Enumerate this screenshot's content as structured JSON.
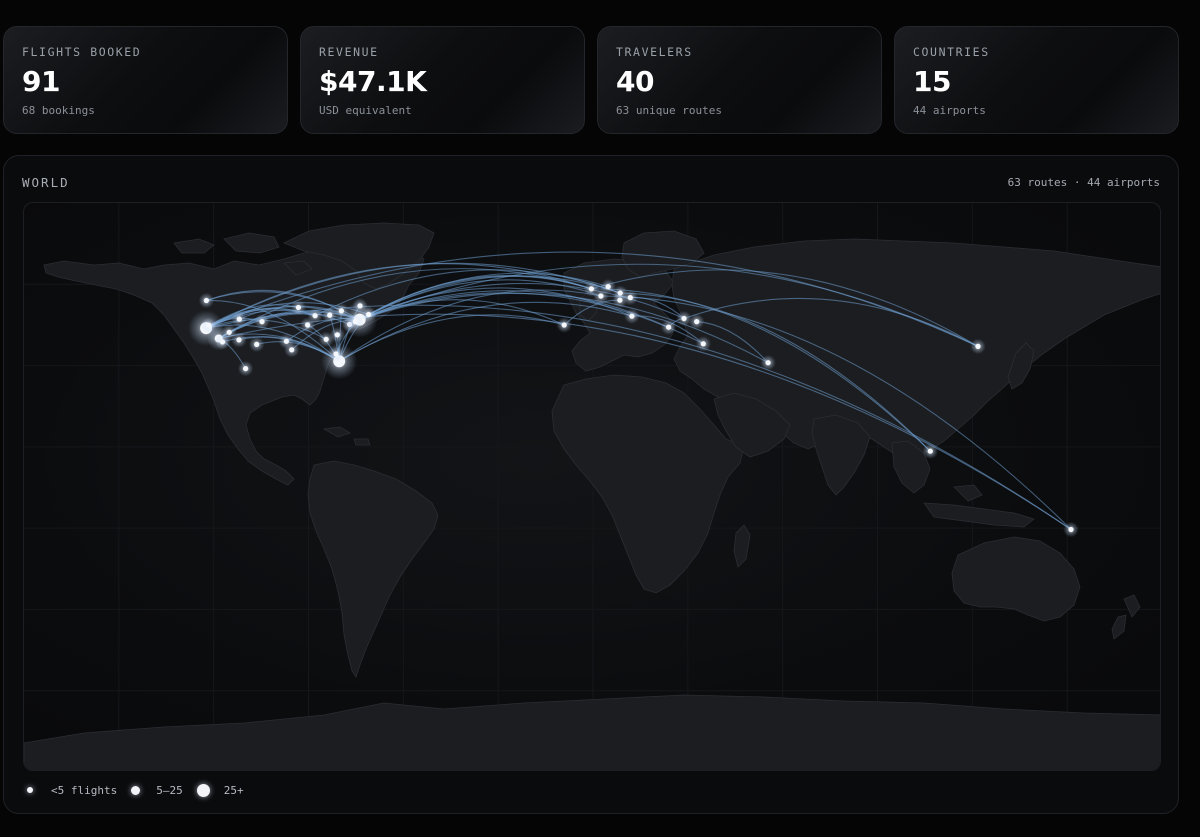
{
  "stats": [
    {
      "label": "FLIGHTS BOOKED",
      "value": "91",
      "sub": "68 bookings"
    },
    {
      "label": "REVENUE",
      "value": "$47.1K",
      "sub": "USD equivalent"
    },
    {
      "label": "TRAVELERS",
      "value": "40",
      "sub": "63 unique routes"
    },
    {
      "label": "COUNTRIES",
      "value": "15",
      "sub": "44 airports"
    }
  ],
  "panel": {
    "title": "WORLD",
    "meta": "63 routes · 44 airports"
  },
  "legend": {
    "small": "<5 flights",
    "medium": "5–25",
    "large": "25+"
  },
  "colors": {
    "route": "#6f9fd0",
    "airport": "#f4f7fb",
    "land": "#1b1d20",
    "background": "#050506"
  },
  "airports": [
    {
      "lon": -122.4,
      "lat": 37.6,
      "tier": "large"
    },
    {
      "lon": -118.4,
      "lat": 33.9,
      "tier": "medium"
    },
    {
      "lon": -122.3,
      "lat": 47.4,
      "tier": "small"
    },
    {
      "lon": -121.5,
      "lat": 38.6,
      "tier": "small"
    },
    {
      "lon": -111.9,
      "lat": 40.8,
      "tier": "small"
    },
    {
      "lon": -104.7,
      "lat": 39.9,
      "tier": "small"
    },
    {
      "lon": -112.0,
      "lat": 33.4,
      "tier": "small"
    },
    {
      "lon": -115.1,
      "lat": 36.1,
      "tier": "small"
    },
    {
      "lon": -117.2,
      "lat": 32.7,
      "tier": "small"
    },
    {
      "lon": -97.0,
      "lat": 32.9,
      "tier": "small"
    },
    {
      "lon": -95.3,
      "lat": 29.9,
      "tier": "small"
    },
    {
      "lon": -93.2,
      "lat": 44.9,
      "tier": "small"
    },
    {
      "lon": -87.9,
      "lat": 42.0,
      "tier": "small"
    },
    {
      "lon": -90.3,
      "lat": 38.7,
      "tier": "small"
    },
    {
      "lon": -84.4,
      "lat": 33.6,
      "tier": "small"
    },
    {
      "lon": -83.3,
      "lat": 42.2,
      "tier": "small"
    },
    {
      "lon": -77.0,
      "lat": 38.9,
      "tier": "small"
    },
    {
      "lon": -73.8,
      "lat": 40.6,
      "tier": "large"
    },
    {
      "lon": -71.0,
      "lat": 42.4,
      "tier": "small"
    },
    {
      "lon": -73.7,
      "lat": 45.5,
      "tier": "small"
    },
    {
      "lon": -80.3,
      "lat": 25.8,
      "tier": "large"
    },
    {
      "lon": -81.3,
      "lat": 28.4,
      "tier": "small"
    },
    {
      "lon": -80.9,
      "lat": 35.2,
      "tier": "small"
    },
    {
      "lon": -79.6,
      "lat": 43.7,
      "tier": "small"
    },
    {
      "lon": -75.2,
      "lat": 39.9,
      "tier": "small"
    },
    {
      "lon": -106.4,
      "lat": 31.8,
      "tier": "small"
    },
    {
      "lon": -109.9,
      "lat": 23.2,
      "tier": "small"
    },
    {
      "lon": -9.1,
      "lat": 38.7,
      "tier": "small"
    },
    {
      "lon": 2.5,
      "lat": 49.0,
      "tier": "small"
    },
    {
      "lon": -0.5,
      "lat": 51.5,
      "tier": "small"
    },
    {
      "lon": 4.8,
      "lat": 52.3,
      "tier": "small"
    },
    {
      "lon": 8.6,
      "lat": 50.0,
      "tier": "small"
    },
    {
      "lon": 8.5,
      "lat": 47.5,
      "tier": "small"
    },
    {
      "lon": 11.8,
      "lat": 48.4,
      "tier": "small"
    },
    {
      "lon": 12.3,
      "lat": 41.8,
      "tier": "small"
    },
    {
      "lon": 23.9,
      "lat": 37.9,
      "tier": "small"
    },
    {
      "lon": 28.8,
      "lat": 41.0,
      "tier": "small"
    },
    {
      "lon": 32.8,
      "lat": 39.9,
      "tier": "small"
    },
    {
      "lon": 34.9,
      "lat": 32.0,
      "tier": "small"
    },
    {
      "lon": 55.4,
      "lat": 25.3,
      "tier": "small"
    },
    {
      "lon": 121.8,
      "lat": 31.1,
      "tier": "small"
    },
    {
      "lon": 106.7,
      "lat": -6.1,
      "tier": "small"
    },
    {
      "lon": 151.2,
      "lat": -33.9,
      "tier": "small"
    }
  ],
  "routes": [
    [
      -122.4,
      37.6,
      -73.8,
      40.6
    ],
    [
      -122.4,
      37.6,
      -80.3,
      25.8
    ],
    [
      -122.4,
      37.6,
      -87.9,
      42.0
    ],
    [
      -122.4,
      37.6,
      -71.0,
      42.4
    ],
    [
      -122.4,
      37.6,
      -77.0,
      38.9
    ],
    [
      -122.4,
      37.6,
      -84.4,
      33.6
    ],
    [
      -122.4,
      37.6,
      -104.7,
      39.9
    ],
    [
      -122.4,
      37.6,
      -93.2,
      44.9
    ],
    [
      -118.4,
      33.9,
      -73.8,
      40.6
    ],
    [
      -118.4,
      33.9,
      -80.3,
      25.8
    ],
    [
      -118.4,
      33.9,
      -87.9,
      42.0
    ],
    [
      -118.4,
      33.9,
      -75.2,
      39.9
    ],
    [
      -122.3,
      47.4,
      -73.8,
      40.6
    ],
    [
      -122.3,
      47.4,
      -80.3,
      25.8
    ],
    [
      -122.3,
      47.4,
      -79.6,
      43.7
    ],
    [
      -121.5,
      38.6,
      -87.9,
      42.0
    ],
    [
      -111.9,
      40.8,
      -73.8,
      40.6
    ],
    [
      -112.0,
      33.4,
      -80.3,
      25.8
    ],
    [
      -115.1,
      36.1,
      -73.8,
      40.6
    ],
    [
      -117.2,
      32.7,
      -80.3,
      25.8
    ],
    [
      -97.0,
      32.9,
      -73.8,
      40.6
    ],
    [
      -95.3,
      29.9,
      -73.8,
      40.6
    ],
    [
      -90.3,
      38.7,
      -80.3,
      25.8
    ],
    [
      -106.4,
      31.8,
      -80.3,
      25.8
    ],
    [
      -109.9,
      23.2,
      -118.4,
      33.9
    ],
    [
      -81.3,
      28.4,
      -73.8,
      40.6
    ],
    [
      -80.9,
      35.2,
      -80.3,
      25.8
    ],
    [
      -83.3,
      42.2,
      -80.3,
      25.8
    ],
    [
      -73.7,
      45.5,
      -80.3,
      25.8
    ],
    [
      -71.0,
      42.4,
      -80.3,
      25.8
    ],
    [
      -79.6,
      43.7,
      -80.3,
      25.8
    ],
    [
      -73.8,
      40.6,
      -0.5,
      51.5
    ],
    [
      -73.8,
      40.6,
      2.5,
      49.0
    ],
    [
      -73.8,
      40.6,
      -9.1,
      38.7
    ],
    [
      -73.8,
      40.6,
      8.6,
      50.0
    ],
    [
      -73.8,
      40.6,
      12.3,
      41.8
    ],
    [
      -73.8,
      40.6,
      28.8,
      41.0
    ],
    [
      -73.8,
      40.6,
      34.9,
      32.0
    ],
    [
      -73.8,
      40.6,
      4.8,
      52.3
    ],
    [
      -80.3,
      25.8,
      -9.1,
      38.7
    ],
    [
      -80.3,
      25.8,
      2.5,
      49.0
    ],
    [
      -80.3,
      25.8,
      12.3,
      41.8
    ],
    [
      -122.4,
      37.6,
      -0.5,
      51.5
    ],
    [
      -122.4,
      37.6,
      8.6,
      50.0
    ],
    [
      -122.4,
      37.6,
      121.8,
      31.1
    ],
    [
      -122.4,
      37.6,
      151.2,
      -33.9
    ],
    [
      -118.4,
      33.9,
      151.2,
      -33.9
    ],
    [
      -118.4,
      33.9,
      -0.5,
      51.5
    ],
    [
      -87.9,
      42.0,
      8.6,
      50.0
    ],
    [
      -77.0,
      38.9,
      23.9,
      37.9
    ],
    [
      -73.8,
      40.6,
      55.4,
      25.3
    ],
    [
      -73.8,
      40.6,
      121.8,
      31.1
    ],
    [
      -0.5,
      51.5,
      121.8,
      31.1
    ],
    [
      -0.5,
      51.5,
      106.7,
      -6.1
    ],
    [
      2.5,
      49.0,
      151.2,
      -33.9
    ],
    [
      8.6,
      50.0,
      106.7,
      -6.1
    ],
    [
      28.8,
      41.0,
      121.8,
      31.1
    ],
    [
      32.8,
      39.9,
      55.4,
      25.3
    ],
    [
      11.8,
      48.4,
      28.8,
      41.0
    ],
    [
      -9.1,
      38.7,
      8.5,
      47.5
    ],
    [
      12.3,
      41.8,
      34.9,
      32.0
    ],
    [
      23.9,
      37.9,
      28.8,
      41.0
    ],
    [
      -71.0,
      42.4,
      -0.5,
      51.5
    ]
  ]
}
